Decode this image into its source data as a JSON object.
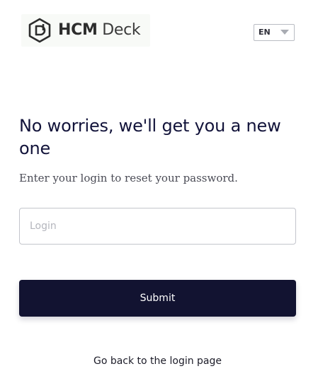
{
  "header": {
    "logo": {
      "icon": "hcm-deck-hexagon-logo-icon",
      "brand_bold": "HCM",
      "brand_light": " Deck"
    },
    "language": {
      "selected": "EN",
      "icon": "caret-down-icon"
    }
  },
  "main": {
    "heading": "No worries, we'll get you a new one",
    "subtitle": "Enter your login to reset your password.",
    "login_field": {
      "value": "",
      "placeholder": "Login"
    },
    "submit_label": "Submit",
    "back_link": "Go back to the login page"
  },
  "colors": {
    "primary": "#121331",
    "text": "#12133a",
    "border": "#c3c5cc",
    "placeholder": "#b4b6bd"
  }
}
